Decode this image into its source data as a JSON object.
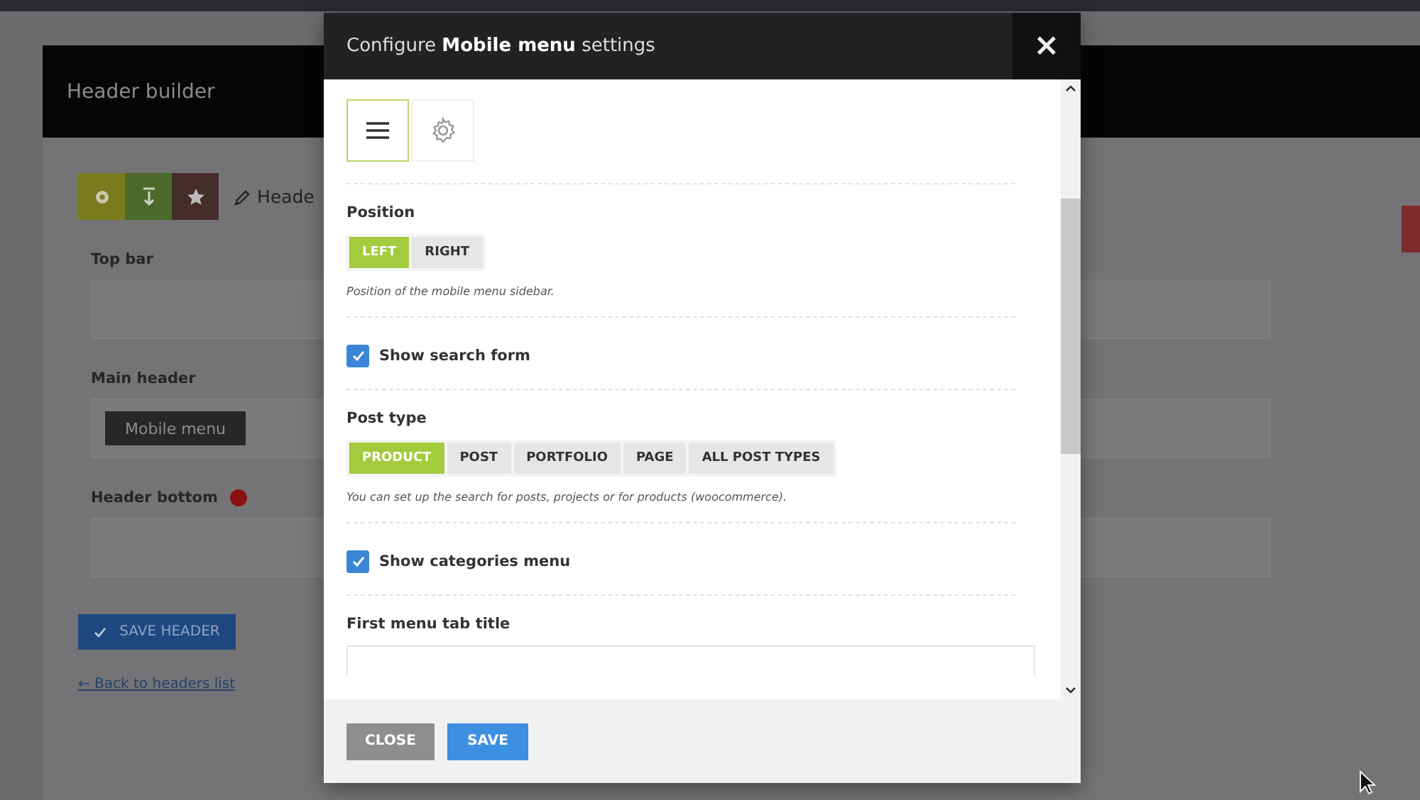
{
  "page": {
    "title": "Header builder",
    "toolbar_label": "Heade",
    "sections": [
      {
        "label": "Top bar",
        "kind": "empty",
        "warning": false
      },
      {
        "label": "Main header",
        "kind": "element",
        "element": "Mobile menu",
        "warning": false
      },
      {
        "label": "Header bottom",
        "kind": "empty",
        "warning": true
      }
    ],
    "save_button": "SAVE HEADER",
    "back_link": "← Back to headers list"
  },
  "dialog": {
    "title_prefix": "Configure",
    "title_bold": "Mobile menu",
    "title_suffix": "settings",
    "close": "×",
    "icon_type": [
      {
        "kind": "hamburger",
        "selected": true
      },
      {
        "kind": "gear",
        "selected": false
      }
    ],
    "position": {
      "label": "Position",
      "options": [
        {
          "label": "LEFT",
          "selected": true
        },
        {
          "label": "RIGHT",
          "selected": false
        }
      ],
      "hint": "Position of the mobile menu sidebar."
    },
    "show_search": {
      "label": "Show search form",
      "checked": true
    },
    "post_type": {
      "label": "Post type",
      "options": [
        {
          "label": "PRODUCT",
          "selected": true
        },
        {
          "label": "POST",
          "selected": false
        },
        {
          "label": "PORTFOLIO",
          "selected": false
        },
        {
          "label": "PAGE",
          "selected": false
        },
        {
          "label": "ALL POST TYPES",
          "selected": false
        }
      ],
      "hint": "You can set up the search for posts, projects or for products (woocommerce)."
    },
    "show_categories": {
      "label": "Show categories menu",
      "checked": true
    },
    "first_tab_title": {
      "label": "First menu tab title"
    },
    "buttons": [
      {
        "label": "CLOSE",
        "kind": "secondary"
      },
      {
        "label": "SAVE",
        "kind": "primary"
      }
    ]
  }
}
